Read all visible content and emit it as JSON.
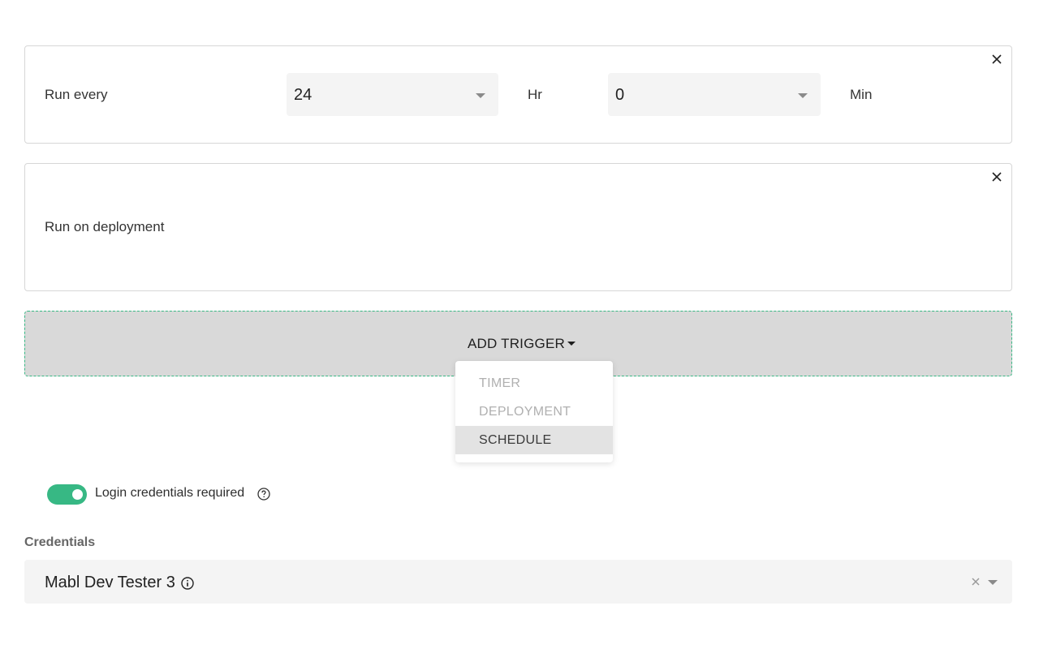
{
  "timer_trigger": {
    "label": "Run every",
    "hours_value": "24",
    "hours_unit": "Hr",
    "minutes_value": "0",
    "minutes_unit": "Min",
    "close_icon": "close-icon"
  },
  "deployment_trigger": {
    "label": "Run on deployment",
    "close_icon": "close-icon"
  },
  "add_trigger": {
    "button_label": "ADD TRIGGER",
    "menu_items": [
      {
        "label": "TIMER",
        "state": "disabled"
      },
      {
        "label": "DEPLOYMENT",
        "state": "disabled"
      },
      {
        "label": "SCHEDULE",
        "state": "hovered"
      }
    ]
  },
  "login": {
    "toggle_on": true,
    "label": "Login credentials required",
    "help_icon": "question-circle-icon"
  },
  "credentials": {
    "label": "Credentials",
    "selected_value": "Mabl Dev Tester 3",
    "info_icon": "info-circle-icon"
  },
  "colors": {
    "accent": "#37b884",
    "field_bg": "#f4f4f4",
    "dropzone_bg": "#d9d9d9"
  }
}
